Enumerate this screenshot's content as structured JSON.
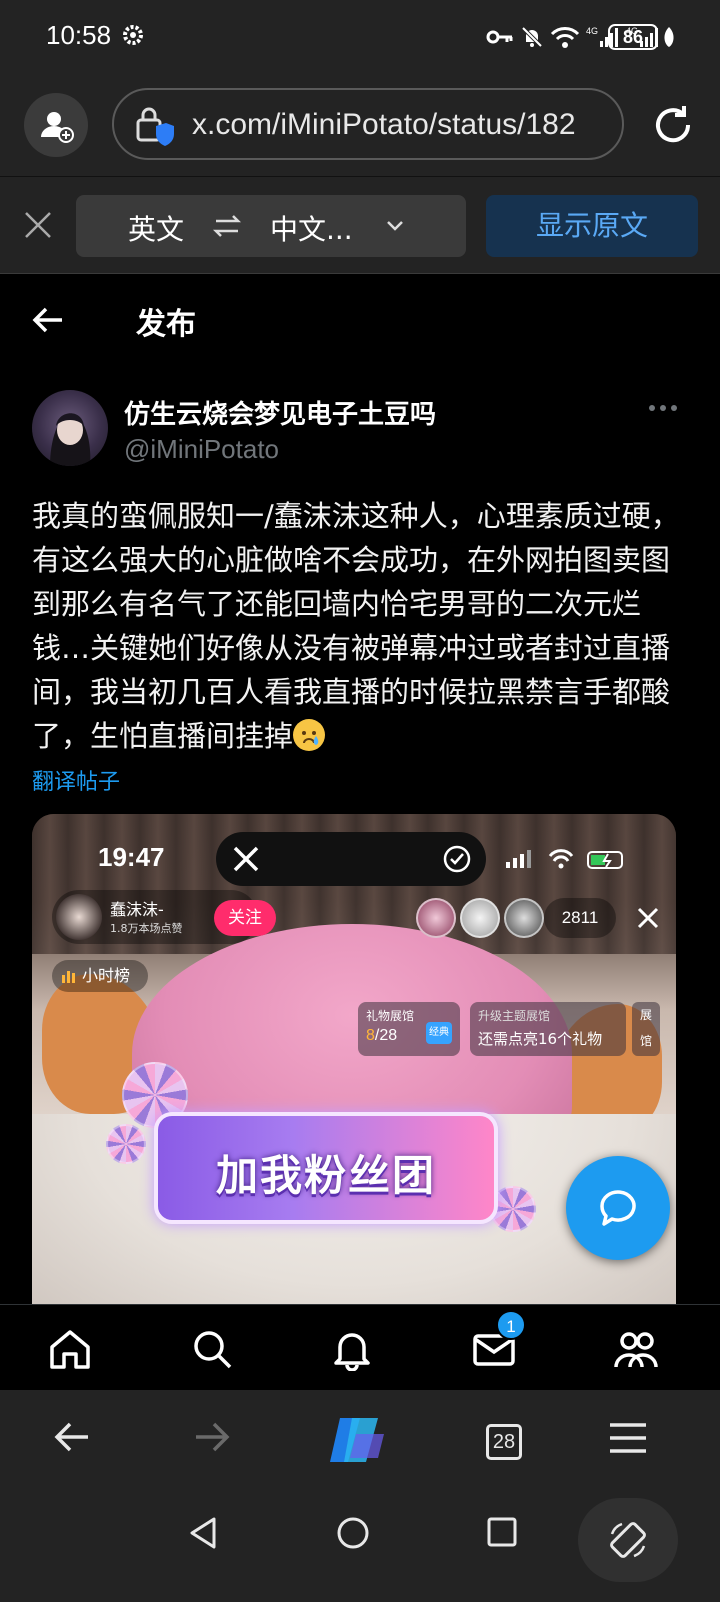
{
  "status_bar": {
    "time": "10:58",
    "battery": "86"
  },
  "browser": {
    "url": "x.com/iMiniPotato/status/182",
    "icons": [
      "profile-icon",
      "lock-shield-icon",
      "reload-icon"
    ]
  },
  "translate_bar": {
    "source_lang": "英文",
    "target_lang": "中文...",
    "show_original": "显示原文"
  },
  "page": {
    "title": "发布"
  },
  "tweet": {
    "display_name": "仿生云烧会梦见电子土豆吗",
    "handle": "@iMiniPotato",
    "text": "我真的蛮佩服知一/蠢沫沫这种人，心理素质过硬，有这么强大的心脏做啥不会成功，在外网拍图卖图到那么有名气了还能回墙内恰宅男哥的二次元烂钱…关键她们好像从没有被弹幕冲过或者封过直播间，我当初几百人看我直播的时候拉黑禁言手都酸了，生怕直播间挂掉",
    "translate_link": "翻译帖子"
  },
  "media": {
    "time": "19:47",
    "streamer_name": "蠢沫沫-",
    "streamer_likes": "1.8万本场点赞",
    "follow": "关注",
    "viewer_count": "2811",
    "rank": "小时榜",
    "gift_label": "礼物展馆",
    "gift_value_current": "8",
    "gift_value_total": "/28",
    "gift_badge": "经典",
    "theme_label": "升级主题展馆",
    "theme_value": "还需点亮16个礼物",
    "hall_label_1": "展",
    "hall_label_2": "馆",
    "banner": "加我粉丝团"
  },
  "x_tabbar": {
    "messages_badge": "1"
  },
  "browser_bar": {
    "tabs_count": "28"
  },
  "colors": {
    "accent": "#1d9bf0",
    "bg": "#000000",
    "chrome": "#232323"
  }
}
